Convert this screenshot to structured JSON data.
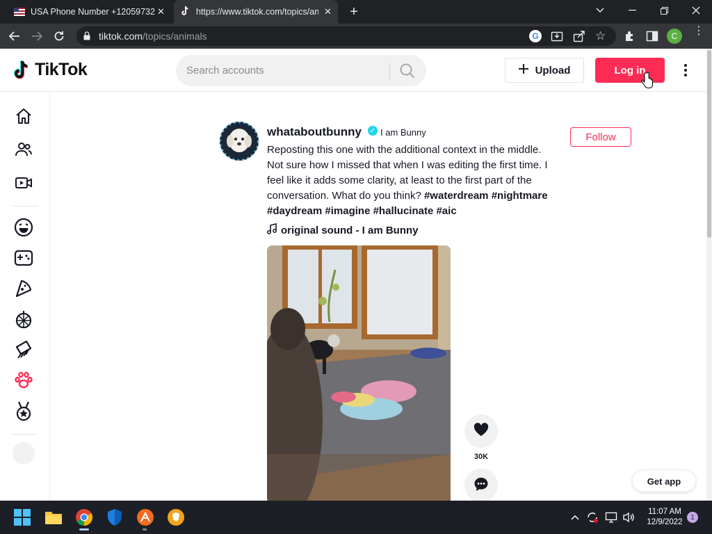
{
  "browser": {
    "tabs": [
      {
        "title": "USA Phone Number +12059732",
        "close": "✕"
      },
      {
        "title": "https://www.tiktok.com/topics/an",
        "close": "✕"
      }
    ],
    "new_tab": "+",
    "url_domain": "tiktok.com",
    "url_path": "/topics/animals",
    "profile_initial": "C"
  },
  "header": {
    "logo": "TikTok",
    "search_placeholder": "Search accounts",
    "upload_label": "Upload",
    "login_label": "Log in"
  },
  "post": {
    "username": "whataboutbunny",
    "nickname": "I am Bunny",
    "follow_label": "Follow",
    "caption_text": "Reposting this one with the additional context in the middle. Not sure how I missed that when I was editing the first time. I feel like it adds some clarity, at least to the first part of the conversation. What do you think?",
    "hashtags": [
      "#waterdream",
      "#nightmare",
      "#daydream",
      "#imagine",
      "#hallucinate",
      "#aic"
    ],
    "music": "original sound - I am Bunny",
    "likes": "30K"
  },
  "get_app_label": "Get app",
  "taskbar": {
    "time": "11:07 AM",
    "date": "12/9/2022",
    "notifications": "1"
  },
  "colors": {
    "brand": "#fe2c55",
    "chrome_dark": "#202124",
    "verified": "#20d5ec"
  },
  "icons": {
    "sidebar": [
      "home-icon",
      "following-icon",
      "live-icon",
      "comedy-icon",
      "gaming-icon",
      "food-icon",
      "dance-icon",
      "beauty-icon",
      "animals-icon",
      "sports-icon"
    ]
  }
}
